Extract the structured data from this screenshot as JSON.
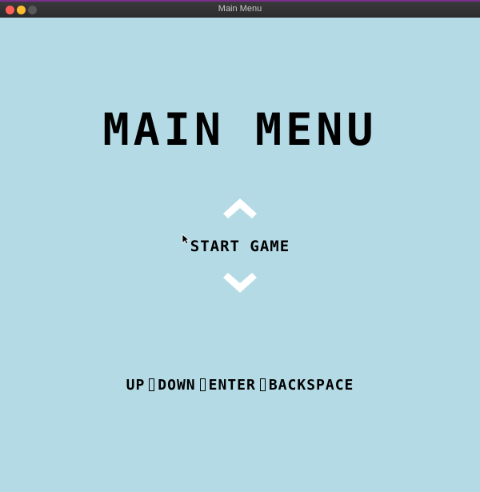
{
  "window": {
    "title": "Main Menu"
  },
  "menu": {
    "title": "MAIN MENU",
    "selected_option": "START GAME",
    "up_arrow_icon": "chevron-up-icon",
    "down_arrow_icon": "chevron-down-icon"
  },
  "controls": {
    "up": "UP",
    "down": "DOWN",
    "enter": "ENTER",
    "backspace": "BACKSPACE"
  },
  "colors": {
    "background": "#b3dae5",
    "text": "#000000",
    "arrow": "#ffffff"
  }
}
